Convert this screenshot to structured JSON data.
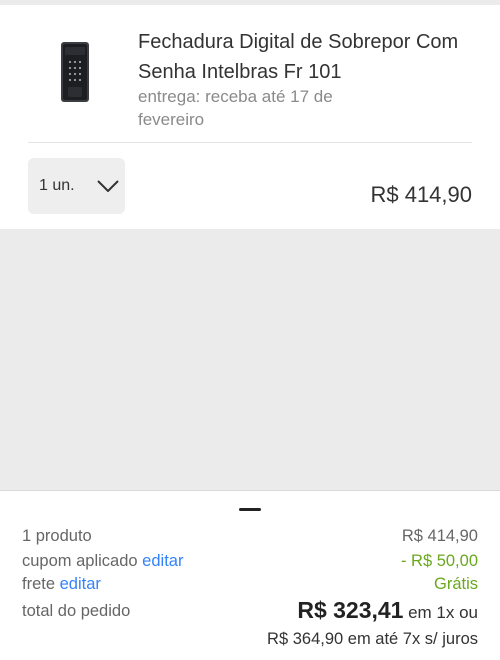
{
  "item": {
    "title": "Fechadura Digital de Sobrepor Com Senha Intelbras Fr 101",
    "delivery": "entrega: receba até 17 de fevereiro",
    "quantity": "1 un.",
    "price": "R$ 414,90",
    "image_icon": "digital-lock-icon"
  },
  "summary": {
    "products_label": "1 produto",
    "products_value": "R$ 414,90",
    "coupon_label": "cupom aplicado",
    "coupon_edit": "editar",
    "coupon_value": "- R$ 50,00",
    "shipping_label": "frete",
    "shipping_edit": "editar",
    "shipping_value": "Grátis",
    "total_label": "total do pedido",
    "total_value": "R$ 323,41",
    "total_suffix": "em 1x ou",
    "installments": "R$ 364,90 em até 7x s/ juros"
  },
  "colors": {
    "link": "#3483fa",
    "discount": "#6aa81e",
    "background": "#ebebeb"
  }
}
